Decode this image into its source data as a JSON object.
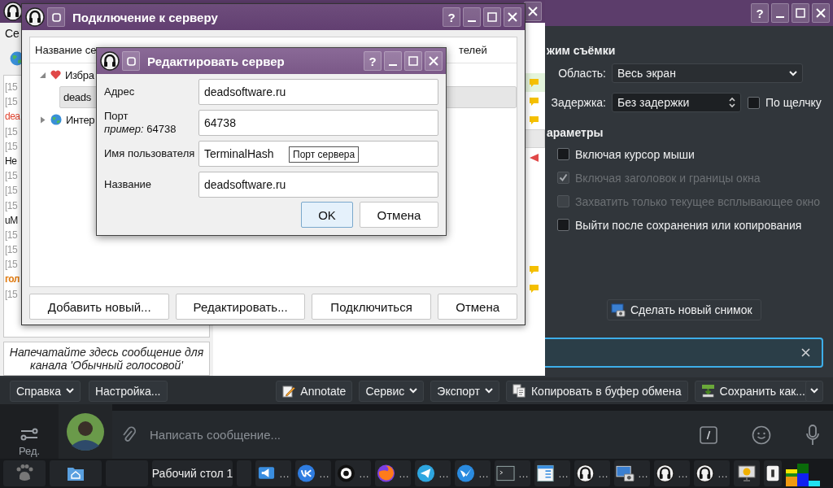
{
  "spectacle": {
    "help": "?",
    "capture_heading": "жим съёмки",
    "area_label": "Область:",
    "area_value": "Весь экран",
    "delay_label": "Задержка:",
    "delay_value": "Без задержки",
    "on_click": {
      "label": "По щелчку",
      "checked": false
    },
    "options_heading": "араметры",
    "options": [
      {
        "label": "Включая курсор мыши",
        "checked": false,
        "disabled": false
      },
      {
        "label": "Включая заголовок и границы окна",
        "checked": true,
        "disabled": true
      },
      {
        "label": "Захватить только текущее всплывающее окно",
        "checked": false,
        "disabled": true
      },
      {
        "label": "Выйти после сохранения или копирования",
        "checked": false,
        "disabled": false
      }
    ],
    "new_screenshot": "Сделать новый снимок",
    "toolbar_left": [
      {
        "label": "Справка",
        "kind": "menu"
      },
      {
        "label": "Настройка...",
        "kind": "plain"
      }
    ],
    "toolbar_right": [
      {
        "label": "Annotate",
        "kind": "annotate"
      },
      {
        "label": "Сервис",
        "kind": "menu"
      },
      {
        "label": "Экспорт",
        "kind": "menu"
      },
      {
        "label": "Копировать в буфер обмена",
        "kind": "copy"
      },
      {
        "label": "Сохранить как...",
        "kind": "split"
      }
    ]
  },
  "mumble": {
    "menu": [
      "Се"
    ],
    "chat_log": [
      {
        "text": "[15",
        "kind": "time"
      },
      {
        "text": "[15",
        "kind": "time"
      },
      {
        "text": "dea",
        "kind": "user"
      },
      {
        "text": "[15",
        "kind": "time"
      },
      {
        "text": "[15",
        "kind": "time"
      },
      {
        "text": "Не",
        "kind": "text"
      },
      {
        "text": "[15",
        "kind": "time"
      },
      {
        "text": "[15",
        "kind": "time"
      },
      {
        "text": "[15",
        "kind": "time"
      },
      {
        "text": "uM",
        "kind": "text"
      },
      {
        "text": "[15",
        "kind": "time"
      },
      {
        "text": "[15",
        "kind": "time"
      },
      {
        "text": "[15",
        "kind": "time"
      },
      {
        "text": "гол",
        "kind": "channel"
      },
      {
        "text": "[15",
        "kind": "time"
      }
    ],
    "message_placeholder": "Напечатайте здесь сообщение для канала 'Обычный голосовой'"
  },
  "connect_dialog": {
    "title": "Подключение к серверу",
    "help": "?",
    "columns": [
      "Название се",
      "телей"
    ],
    "tree": [
      {
        "label": "Избра",
        "kind": "favorites",
        "expanded": true,
        "selected": false,
        "children": [
          {
            "label": "deads",
            "selected": true
          }
        ]
      },
      {
        "label": "Интер",
        "kind": "internet",
        "expanded": false,
        "selected": false
      }
    ],
    "buttons": [
      "Добавить новый...",
      "Редактировать...",
      "Подключиться",
      "Отмена"
    ]
  },
  "edit_dialog": {
    "title": "Редактировать сервер",
    "help": "?",
    "fields": [
      {
        "label": "Адрес",
        "value": "deadsoftware.ru"
      },
      {
        "label": "Порт",
        "hint": "*пример:* 64738",
        "value": "64738"
      },
      {
        "label": "Имя пользователя",
        "value": "TerminalHash"
      },
      {
        "label": "Название",
        "value": "deadsoftware.ru"
      }
    ],
    "tooltip": "Порт сервера",
    "buttons": [
      {
        "label": "OK",
        "focused": true
      },
      {
        "label": "Отмена",
        "focused": false
      }
    ]
  },
  "telegram": {
    "sidebar_label": "Ред.",
    "message_placeholder": "Написать сообщение..."
  },
  "taskbar": {
    "desktop_label": "Рабочий стол 1",
    "tasks": [
      {
        "label": "…"
      },
      {
        "label": "…"
      },
      {
        "label": "…"
      },
      {
        "label": "…"
      },
      {
        "label": "…"
      },
      {
        "label": "…"
      },
      {
        "label": "…"
      },
      {
        "label": "…"
      },
      {
        "label": "…"
      },
      {
        "label": "…"
      },
      {
        "label": "…"
      },
      {
        "label": "…"
      }
    ]
  }
}
